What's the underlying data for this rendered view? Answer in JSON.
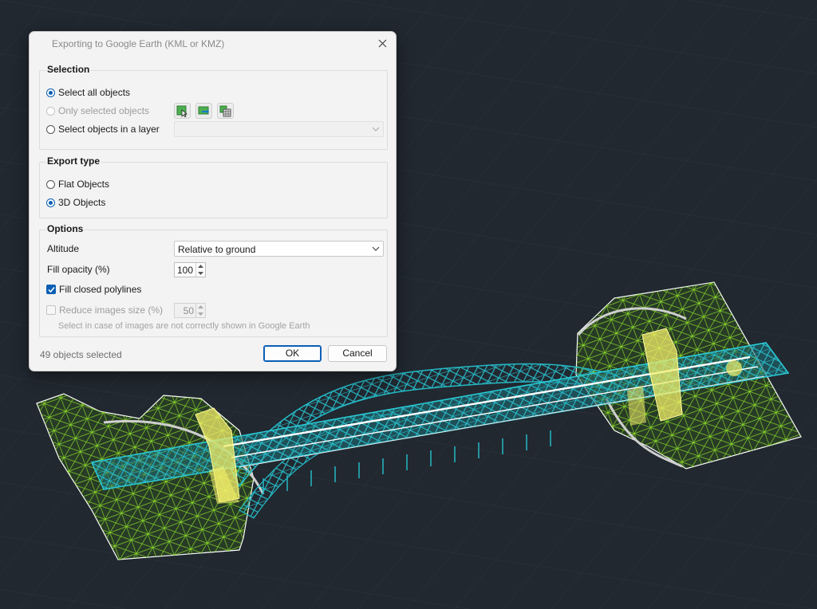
{
  "dialog": {
    "title": "Exporting to Google Earth (KML or KMZ)",
    "selection": {
      "label": "Selection",
      "select_all": "Select all objects",
      "only_selected": "Only selected objects",
      "select_in_layer": "Select objects in a layer",
      "layer_value": ""
    },
    "export_type": {
      "label": "Export type",
      "flat": "Flat Objects",
      "three_d": "3D Objects"
    },
    "options": {
      "label": "Options",
      "altitude_label": "Altitude",
      "altitude_value": "Relative to ground",
      "fill_opacity_label": "Fill opacity (%)",
      "fill_opacity_value": "100",
      "fill_closed_polylines": "Fill closed polylines",
      "reduce_images_label": "Reduce images size (%)",
      "reduce_images_value": "50",
      "hint": "Select in case of images are not correctly shown in Google Earth"
    },
    "status": "49 objects selected",
    "ok_label": "OK",
    "cancel_label": "Cancel"
  },
  "colors": {
    "background": "#212830",
    "accent": "#0a5fb4",
    "terrain_mesh": "#8fdc2a",
    "bridge_structure": "#25b8c4",
    "supports": "#f2ee6a"
  },
  "icons": {
    "close": "close-icon",
    "pick_objects": "select-pick-icon",
    "add_to_selection": "select-add-icon",
    "select_by_table": "select-table-icon",
    "dropdown": "chevron-down-icon"
  }
}
